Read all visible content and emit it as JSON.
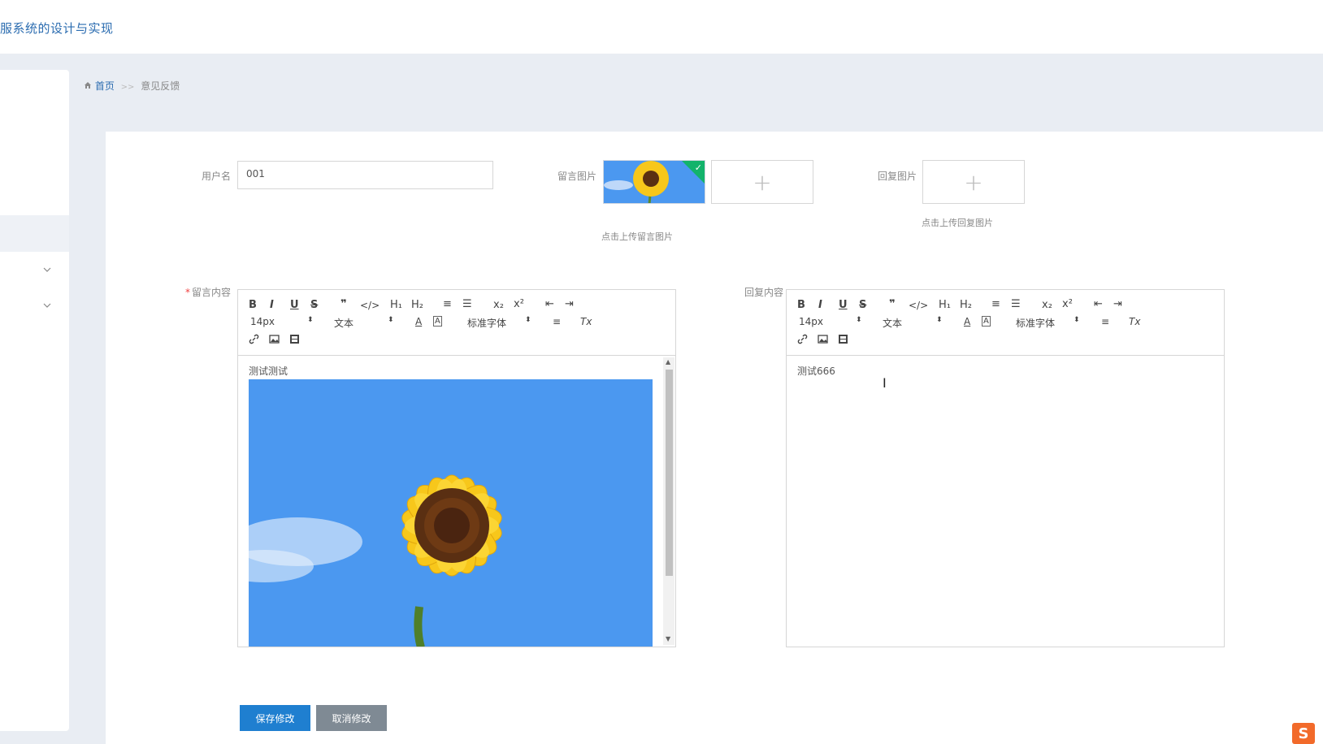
{
  "header": {
    "app_title": "服系统的设计与实现"
  },
  "breadcrumb": {
    "home": "首页",
    "separator": ">>",
    "current": "意见反馈"
  },
  "form": {
    "username_label": "用户名",
    "username_value": "001",
    "message_image_label": "留言图片",
    "message_image_hint": "点击上传留言图片",
    "reply_image_label": "回复图片",
    "reply_image_hint": "点击上传回复图片",
    "message_content_label": "留言内容",
    "required_mark": "*",
    "reply_content_label": "回复内容",
    "message_content_text": "测试测试",
    "reply_content_text": "测试666"
  },
  "toolbar": {
    "bold": "B",
    "italic": "I",
    "underline": "U",
    "strike": "S",
    "quote": "❞",
    "code": "</>",
    "h1": "H₁",
    "h2": "H₂",
    "ordered_list": "≡",
    "bullet_list": "☰",
    "sub": "x₂",
    "sup": "x²",
    "outdent": "⇤",
    "indent": "⇥",
    "size": "14px",
    "header_select": "文本",
    "font_color": "A",
    "bg_color": "A",
    "font_select": "标准字体",
    "align": "≡",
    "clean": "Tx",
    "link": "🔗",
    "image": "▣",
    "video": "▤"
  },
  "buttons": {
    "save": "保存修改",
    "cancel": "取消修改"
  },
  "colors": {
    "accent": "#1f7fd0",
    "success": "#13b36b",
    "sky": "#4b98f0"
  }
}
